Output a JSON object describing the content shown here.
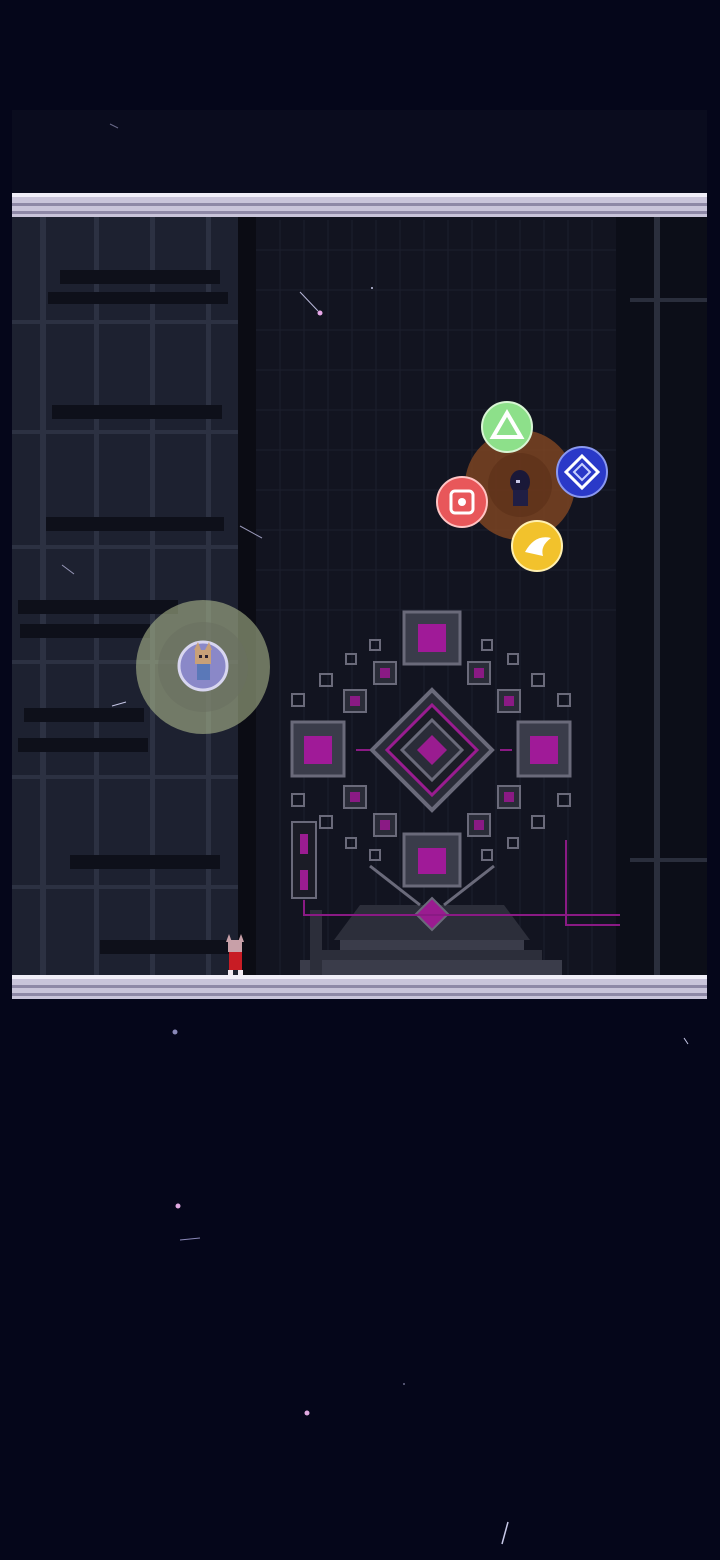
{
  "game": {
    "scene_name": "",
    "colors": {
      "space": "#05061a",
      "wall": "#1b1e2c",
      "platform": "#d8d4e8",
      "accent": "#b01ca8",
      "orb_green": "#8de08a",
      "orb_blue": "#2a39c8",
      "orb_red": "#e8575a",
      "orb_yellow": "#f2c22c",
      "aura_boss": "#8a4a22",
      "aura_ally": "#b8c495"
    },
    "orbs": [
      {
        "name": "green-orb",
        "color": "#8de08a",
        "symbol": "triangle"
      },
      {
        "name": "blue-orb",
        "color": "#2a39c8",
        "symbol": "diamond"
      },
      {
        "name": "red-orb",
        "color": "#e8575a",
        "symbol": "target"
      },
      {
        "name": "yellow-orb",
        "color": "#f2c22c",
        "symbol": "wing"
      }
    ],
    "characters": [
      {
        "name": "boss-character",
        "icon": "dark-figure-icon"
      },
      {
        "name": "ally-character",
        "icon": "fox-girl-icon"
      },
      {
        "name": "player-character",
        "icon": "red-dress-girl-icon"
      }
    ]
  }
}
